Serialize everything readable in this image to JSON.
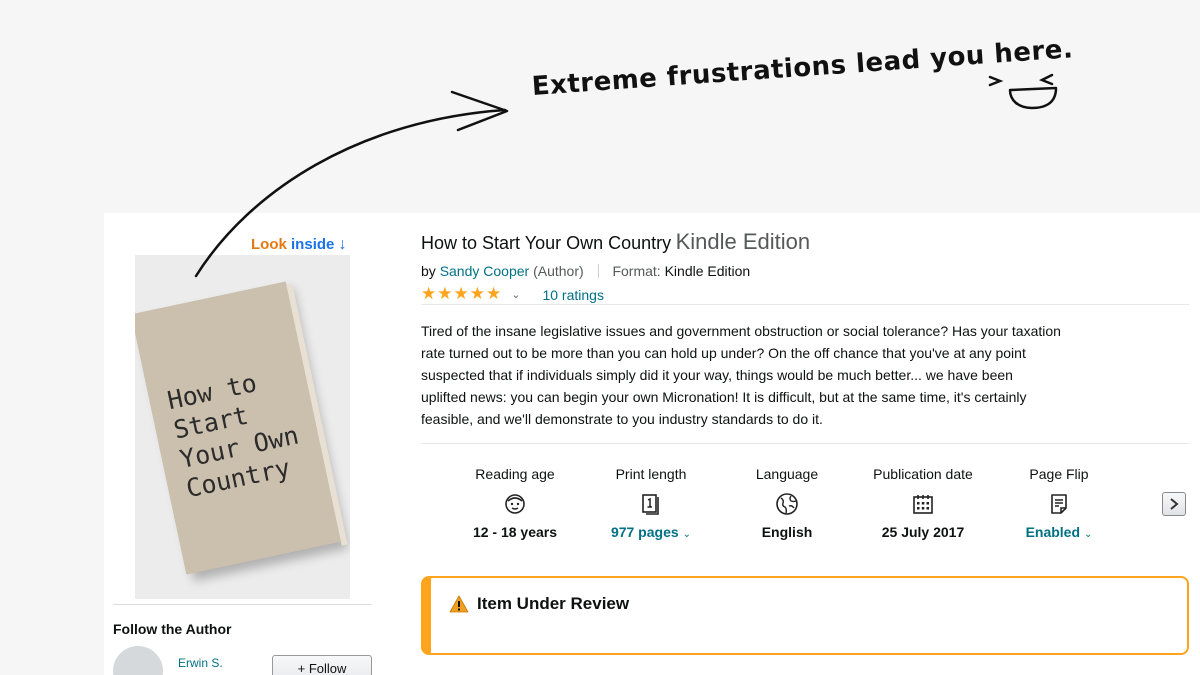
{
  "headline": "Extreme frustrations lead you here.",
  "look_inside": {
    "look": "Look",
    "inside": "inside"
  },
  "cover": {
    "lines": [
      "How to",
      "Start",
      "Your Own",
      "Country"
    ]
  },
  "product": {
    "title": "How to Start Your Own Country",
    "edition": "Kindle Edition",
    "by": "by",
    "author": "Sandy Cooper",
    "author_role": "(Author)",
    "format_label": "Format:",
    "format_value": "Kindle Edition",
    "rating_stars": 5,
    "ratings_count": "10 ratings",
    "description": "Tired of the insane legislative issues and government obstruction or social tolerance? Has your taxation rate turned out to be more than you can hold up under? On the off chance that you've at any point suspected that if individuals simply did it your way, things would be much better... we have been uplifted news: you can begin your own Micronation! It is difficult, but at the same time, it's certainly feasible, and we'll demonstrate to you industry standards to do it."
  },
  "details": [
    {
      "label": "Reading age",
      "icon": "child-face-icon",
      "value": "12 - 18 years",
      "link": false
    },
    {
      "label": "Print length",
      "icon": "pages-icon",
      "value": "977 pages",
      "link": true
    },
    {
      "label": "Language",
      "icon": "globe-icon",
      "value": "English",
      "link": false
    },
    {
      "label": "Publication date",
      "icon": "calendar-icon",
      "value": "25 July 2017",
      "link": false
    },
    {
      "label": "Page Flip",
      "icon": "page-flip-icon",
      "value": "Enabled",
      "link": true
    }
  ],
  "review": {
    "title": "Item Under Review"
  },
  "follow": {
    "title": "Follow the Author",
    "author_name": "Erwin S.",
    "button": "+ Follow"
  },
  "colors": {
    "accent_orange": "#ffa41c",
    "link_teal": "#007185",
    "look_orange": "#e47911",
    "inside_blue": "#1a73e8"
  }
}
